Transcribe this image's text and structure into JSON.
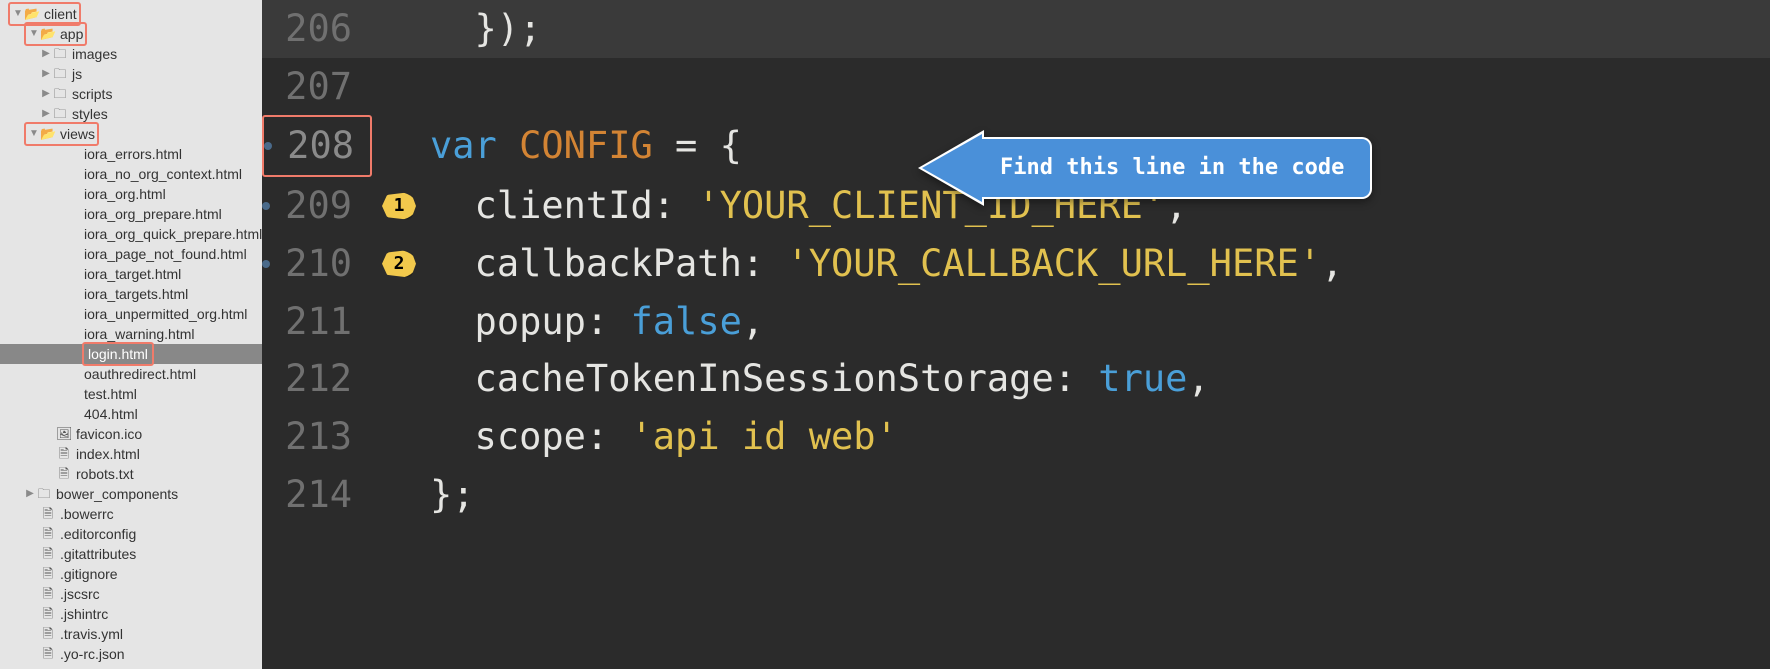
{
  "sidebar": {
    "client": "client",
    "app": "app",
    "images": "images",
    "js": "js",
    "scripts": "scripts",
    "styles": "styles",
    "views": "views",
    "view_files": [
      "iora_errors.html",
      "iora_no_org_context.html",
      "iora_org.html",
      "iora_org_prepare.html",
      "iora_org_quick_prepare.html",
      "iora_page_not_found.html",
      "iora_target.html",
      "iora_targets.html",
      "iora_unpermitted_org.html",
      "iora_warning.html",
      "login.html",
      "oauthredirect.html",
      "test.html",
      "404.html"
    ],
    "favicon": "favicon.ico",
    "index": "index.html",
    "robots": "robots.txt",
    "bower": "bower_components",
    "root_files": [
      ".bowerrc",
      ".editorconfig",
      ".gitattributes",
      ".gitignore",
      ".jscsrc",
      ".jshintrc",
      ".travis.yml",
      ".yo-rc.json"
    ]
  },
  "editor": {
    "lines": [
      {
        "num": "206",
        "tokens": [
          [
            "punct",
            "  });"
          ]
        ]
      },
      {
        "num": "207",
        "tokens": [
          [
            "punct",
            ""
          ]
        ]
      },
      {
        "num": "208",
        "tokens": [
          [
            "kw",
            "var "
          ],
          [
            "var",
            "CONFIG"
          ],
          [
            "punct",
            " = {"
          ]
        ],
        "gutter_hl": true,
        "dirty": true
      },
      {
        "num": "209",
        "tokens": [
          [
            "prop",
            "  clientId"
          ],
          [
            "punct",
            ": "
          ],
          [
            "str",
            "'YOUR_CLIENT_ID_HERE'"
          ],
          [
            "punct",
            ","
          ]
        ],
        "bullet": "1",
        "dirty": true
      },
      {
        "num": "210",
        "tokens": [
          [
            "prop",
            "  callbackPath"
          ],
          [
            "punct",
            ": "
          ],
          [
            "str",
            "'YOUR_CALLBACK_URL_HERE'"
          ],
          [
            "punct",
            ","
          ]
        ],
        "bullet": "2",
        "dirty": true
      },
      {
        "num": "211",
        "tokens": [
          [
            "prop",
            "  popup"
          ],
          [
            "punct",
            ": "
          ],
          [
            "bool",
            "false"
          ],
          [
            "punct",
            ","
          ]
        ]
      },
      {
        "num": "212",
        "tokens": [
          [
            "prop",
            "  cacheTokenInSessionStorage"
          ],
          [
            "punct",
            ": "
          ],
          [
            "bool",
            "true"
          ],
          [
            "punct",
            ","
          ]
        ]
      },
      {
        "num": "213",
        "tokens": [
          [
            "prop",
            "  scope"
          ],
          [
            "punct",
            ": "
          ],
          [
            "str",
            "'api id web'"
          ]
        ]
      },
      {
        "num": "214",
        "tokens": [
          [
            "punct",
            "};"
          ]
        ]
      }
    ]
  },
  "callout": {
    "text": "Find this line in the code"
  }
}
